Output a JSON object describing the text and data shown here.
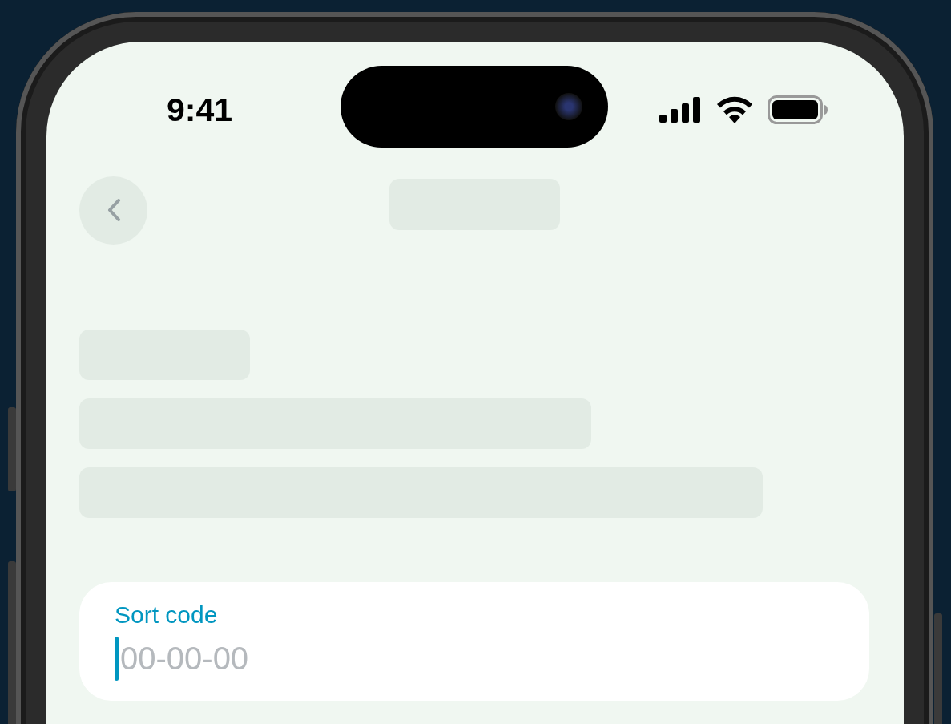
{
  "status_bar": {
    "time": "9:41"
  },
  "field": {
    "label": "Sort code",
    "placeholder": "00-00-00",
    "focused": true
  }
}
